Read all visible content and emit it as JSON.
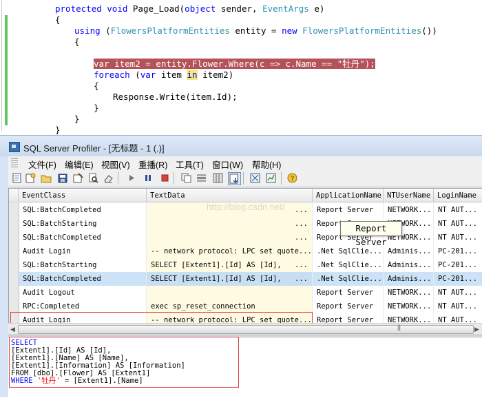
{
  "editor": {
    "lines": [
      {
        "text": "protected void Page_Load(object sender, EventArgs e)"
      },
      {
        "text": "{"
      },
      {
        "text": "using (FlowersPlatformEntities entity = new FlowersPlatformEntities())"
      },
      {
        "text": "{"
      },
      {
        "text": "var item2 = entity.Flower.Where(c => c.Name == \"牡丹\");"
      },
      {
        "text": "foreach (var item in item2)"
      },
      {
        "text": "{"
      },
      {
        "text": "Response.Write(item.Id);"
      },
      {
        "text": "}"
      },
      {
        "text": "}"
      },
      {
        "text": "}"
      }
    ]
  },
  "window": {
    "title": "SQL Server Profiler - [无标题 - 1 (.)]"
  },
  "menu": [
    "文件(F)",
    "编辑(E)",
    "视图(V)",
    "重播(R)",
    "工具(T)",
    "窗口(W)",
    "帮助(H)"
  ],
  "toolbar_icons": [
    "new-trace-icon",
    "new-template-icon",
    "open-icon",
    "save-icon",
    "properties-icon",
    "find-icon",
    "clear-icon",
    "run-icon",
    "pause-icon",
    "stop-icon",
    "auto-scroll-icon",
    "step-icon",
    "group-icon",
    "column-filter-icon",
    "capture-icon",
    "chart-icon",
    "help-icon"
  ],
  "grid": {
    "columns": [
      "EventClass",
      "TextData",
      "ApplicationName",
      "NTUserName",
      "LoginName"
    ],
    "rows": [
      {
        "event": "SQL:BatchCompleted",
        "text": "",
        "dots": "...",
        "app": "Report Server",
        "nt": "NETWORK...",
        "login": "NT AUT..."
      },
      {
        "event": "SQL:BatchStarting",
        "text": "",
        "dots": "...",
        "app": "Report Server",
        "nt": "NETWORK...",
        "login": "NT AUT..."
      },
      {
        "event": "SQL:BatchCompleted",
        "text": "",
        "dots": "...",
        "app": "Report Server",
        "nt": "NETWORK...",
        "login": "NT AUT..."
      },
      {
        "event": "Audit Login",
        "text": "-- network protocol: LPC  set quote...",
        "dots": "",
        "app": ".Net SqlClie...",
        "nt": "Adminis...",
        "login": "PC-201..."
      },
      {
        "event": "SQL:BatchStarting",
        "text": "SELECT   [Extent1].[Id] AS [Id],",
        "dots": "...",
        "app": ".Net SqlClie...",
        "nt": "Adminis...",
        "login": "PC-201..."
      },
      {
        "event": "SQL:BatchCompleted",
        "text": "SELECT   [Extent1].[Id] AS [Id],",
        "dots": "...",
        "app": ".Net SqlClie...",
        "nt": "Adminis...",
        "login": "PC-201..."
      },
      {
        "event": "Audit Logout",
        "text": "",
        "dots": "",
        "app": "Report Server",
        "nt": "NETWORK...",
        "login": "NT AUT..."
      },
      {
        "event": "RPC:Completed",
        "text": "exec sp_reset_connection",
        "dots": "",
        "app": "Report Server",
        "nt": "NETWORK...",
        "login": "NT AUT..."
      },
      {
        "event": "Audit Login",
        "text": "-- network protocol: LPC  set quote...",
        "dots": "",
        "app": "Report Server",
        "nt": "NETWORK...",
        "login": "NT AUT..."
      }
    ]
  },
  "tooltip": "Report Server",
  "watermark": "http://blog.csdn.net/",
  "detail": {
    "lines": [
      {
        "text": "SELECT"
      },
      {
        "text": "[Extent1].[Id] AS [Id],"
      },
      {
        "text": "[Extent1].[Name] AS [Name],"
      },
      {
        "text": "[Extent1].[Information] AS [Information]"
      },
      {
        "text": "FROM [dbo].[Flower] AS [Extent1]"
      },
      {
        "text": "WHERE '牡丹' = [Extent1].[Name]"
      }
    ]
  },
  "colors": {
    "highlight": "#b4525a",
    "selected_row": "#cce3f7",
    "annotation": "#e33b3b",
    "change_bar": "#5fc75f"
  }
}
